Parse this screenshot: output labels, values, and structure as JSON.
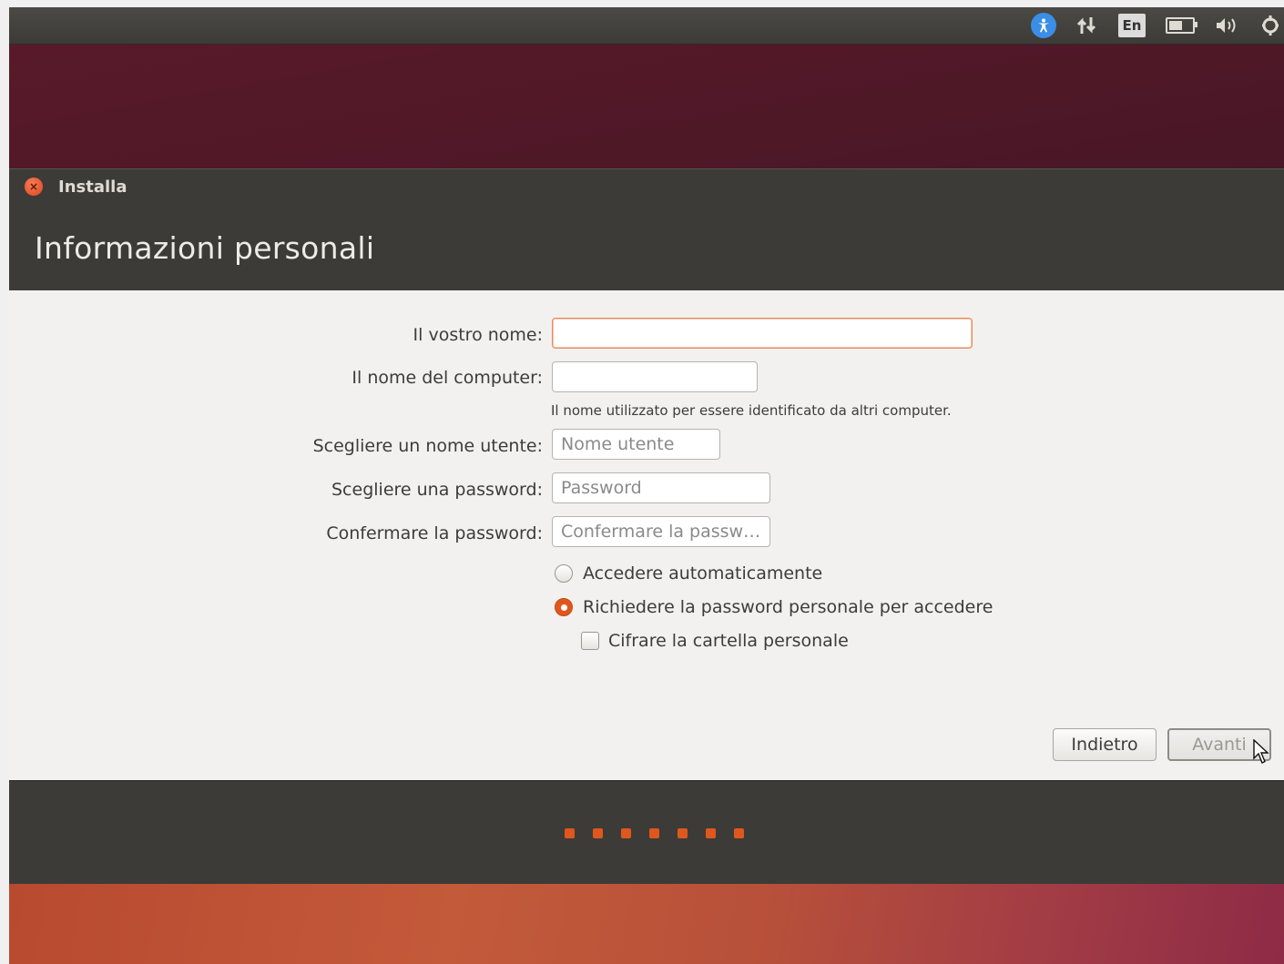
{
  "topbar": {
    "language": "En",
    "battery_level": 0.6
  },
  "window": {
    "title": "Installa",
    "close_glyph": "×"
  },
  "page": {
    "title": "Informazioni personali"
  },
  "form": {
    "name_label": "Il vostro nome:",
    "name_value": "",
    "computer_label": "Il nome del computer:",
    "computer_value": "",
    "computer_hint": "Il nome utilizzato per essere identificato da altri computer.",
    "username_label": "Scegliere un nome utente:",
    "username_placeholder": "Nome utente",
    "password_label": "Scegliere una password:",
    "password_placeholder": "Password",
    "confirm_label": "Confermare la password:",
    "confirm_placeholder": "Confermare la passw…",
    "login_auto_label": "Accedere automaticamente",
    "login_password_label": "Richiedere la password personale per accedere",
    "encrypt_label": "Cifrare la cartella personale",
    "login_mode_selected": "password",
    "encrypt_checked": false
  },
  "buttons": {
    "back_label": "Indietro",
    "next_label": "Avanti"
  },
  "progress": {
    "total_steps": 7
  },
  "colors": {
    "accent": "#e0571e",
    "panel_dark": "#3c3b37",
    "content_bg": "#f2f1f0"
  }
}
